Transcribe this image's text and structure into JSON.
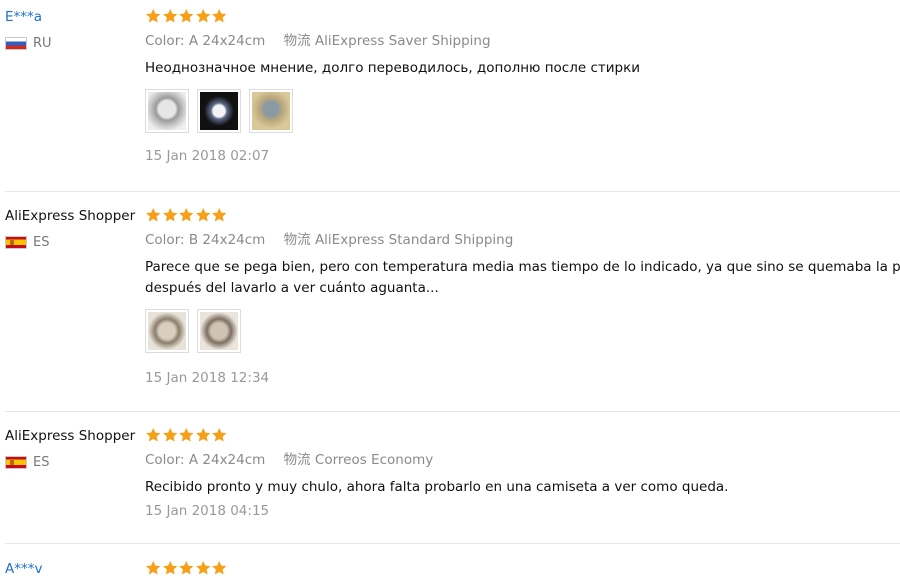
{
  "labels": {
    "color": "Color:",
    "shipping": "物流"
  },
  "star_color": "#f5a018",
  "reviews": [
    {
      "user": "E***a",
      "country": "RU",
      "flag": "ru",
      "rating": 5,
      "color": "A 24x24cm",
      "shipping": "AliExpress Saver Shipping",
      "text": [
        "Неоднозначное мнение, долго переводилось, дополню после стирки"
      ],
      "photos": 3,
      "date": "15 Jan 2018 02:07"
    },
    {
      "user": "AliExpress Shopper",
      "country": "ES",
      "flag": "es",
      "rating": 5,
      "color": "B 24x24cm",
      "shipping": "AliExpress Standard Shipping",
      "text": [
        "Parece que se pega bien, pero con temperatura media mas tiempo de lo indicado, ya que sino se quemaba la p",
        "después del lavarlo a ver cuánto aguanta..."
      ],
      "photos": 2,
      "date": "15 Jan 2018 12:34"
    },
    {
      "user": "AliExpress Shopper",
      "country": "ES",
      "flag": "es",
      "rating": 5,
      "color": "A 24x24cm",
      "shipping": "Correos Economy",
      "text": [
        "Recibido pronto y muy chulo, ahora falta probarlo en una camiseta a ver como queda."
      ],
      "photos": 0,
      "date": "15 Jan 2018 04:15"
    },
    {
      "user": "A***v",
      "country": "",
      "flag": "",
      "rating": 5,
      "color": "",
      "shipping": "",
      "text": [],
      "photos": 0,
      "date": ""
    }
  ]
}
